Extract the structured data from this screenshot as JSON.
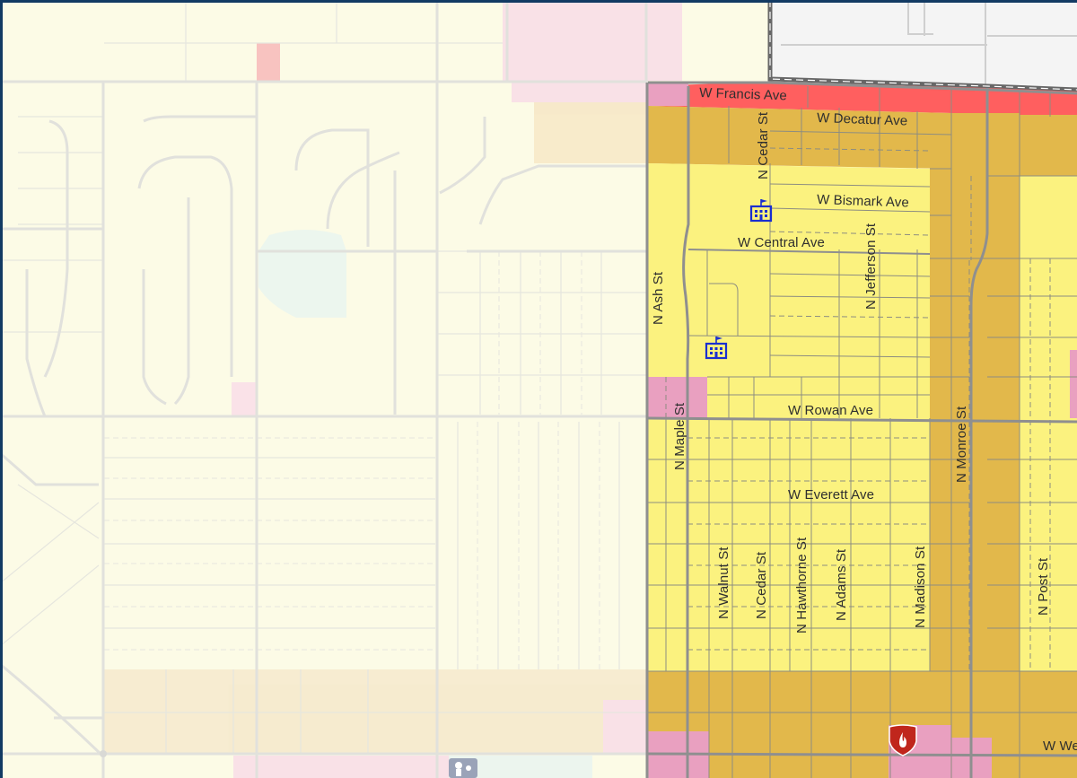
{
  "map": {
    "colors": {
      "outside_background": "#fcfbe6",
      "low_density_residential": "#fbf27f",
      "medium_density_residential": "#e2b84b",
      "commercial_pink": "#e9a0c0",
      "highway_commercial_red": "#ff5f5f",
      "county_gray": "#f4f4f4",
      "school_icon": "#1a2fd0",
      "fire_station_icon": "#c0261c"
    },
    "street_labels": {
      "w_francis_ave": "W Francis Ave",
      "w_decatur_ave": "W Decatur Ave",
      "n_cedar_st_north": "N Cedar St",
      "w_bismark_ave": "W Bismark Ave",
      "w_central_ave": "W Central Ave",
      "n_jefferson_st": "N Jefferson St",
      "n_ash_st": "N Ash St",
      "w_rowan_ave": "W Rowan Ave",
      "n_maple_st": "N Maple St",
      "n_monroe_st": "N Monroe St",
      "w_everett_ave": "W Everett Ave",
      "n_walnut_st": "N Walnut St",
      "n_cedar_st_south": "N Cedar St",
      "n_hawthorne_st": "N Hawthorne St",
      "n_adams_st": "N Adams St",
      "n_madison_st": "N Madison St",
      "n_post_st": "N Post St",
      "w_we_partial": "W We"
    },
    "icons": {
      "school_north": "school-icon",
      "school_south": "school-icon",
      "fire_station": "fire-station-icon",
      "park": "park-icon"
    }
  }
}
